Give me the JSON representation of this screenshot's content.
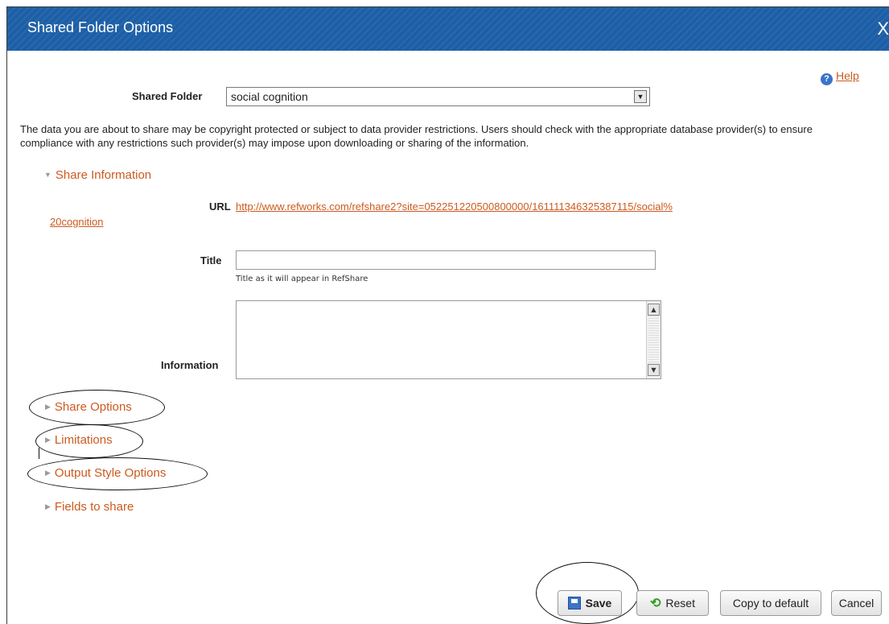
{
  "window": {
    "title": "Shared Folder Options",
    "close_label": "X"
  },
  "help": {
    "icon": "question-circle-icon",
    "label": "Help"
  },
  "shared_folder": {
    "label": "Shared Folder",
    "value": "social cognition",
    "arrow": "▼"
  },
  "notice": "The data you are about to share may be copyright protected or subject to data provider restrictions. Users should check with the appropriate database provider(s) to ensure compliance with any restrictions such provider(s) may impose upon downloading or sharing of the information.",
  "sections": {
    "share_information": "Share Information",
    "share_options": "Share Options",
    "limitations": "Limitations",
    "output_style_options": "Output Style Options",
    "fields_to_share": "Fields to share"
  },
  "share_info": {
    "url_label": "URL",
    "url_line1": "http://www.refworks.com/refshare2?site=052251220500800000/161111346325387115/social%",
    "url_line2": "20cognition",
    "title_label": "Title",
    "title_value": "",
    "title_hint": "Title as it will appear in RefShare",
    "information_label": "Information",
    "information_value": ""
  },
  "buttons": {
    "save": "Save",
    "reset": "Reset",
    "copy_default": "Copy to default",
    "cancel": "Cancel"
  },
  "colors": {
    "titlebar": "#1c5fa6",
    "link": "#cc5a1f"
  }
}
